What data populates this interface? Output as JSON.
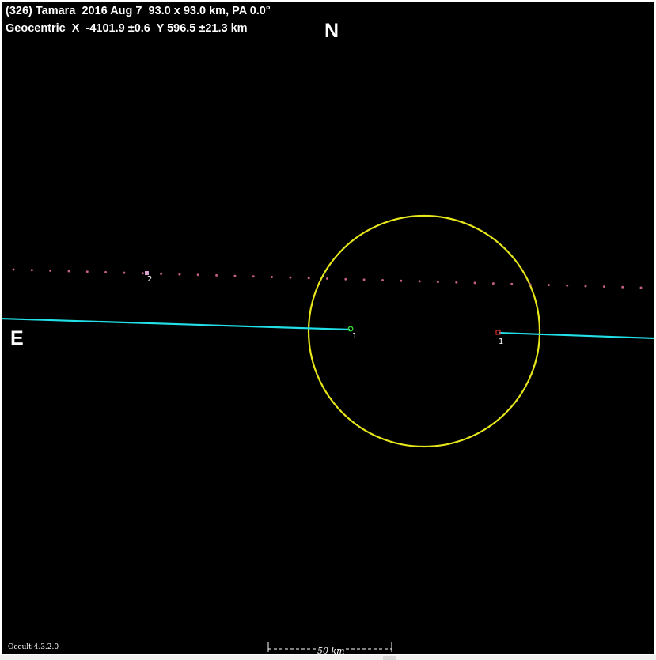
{
  "header": {
    "title": "(326) Tamara  2016 Aug 7  93.0 x 93.0 km, PA 0.0°",
    "geocentric": "Geocentric  X  -4101.9 ±0.6  Y 596.5 ±21.3 km"
  },
  "compass": {
    "north": "N",
    "east": "E"
  },
  "chords": {
    "chord1_label_a": "1",
    "chord1_label_b": "1",
    "chord2_label": "2"
  },
  "footer": {
    "version": "Occult 4.3.2.0",
    "scale": "50 km"
  },
  "colors": {
    "background": "#000000",
    "asteroid_outline": "#e6e61a",
    "chord_line": "#22e0e8",
    "miss_chord": "#c0607a",
    "text": "#ffffff",
    "disappear_marker": "#2fd62f",
    "reappear_marker": "#d83030"
  }
}
